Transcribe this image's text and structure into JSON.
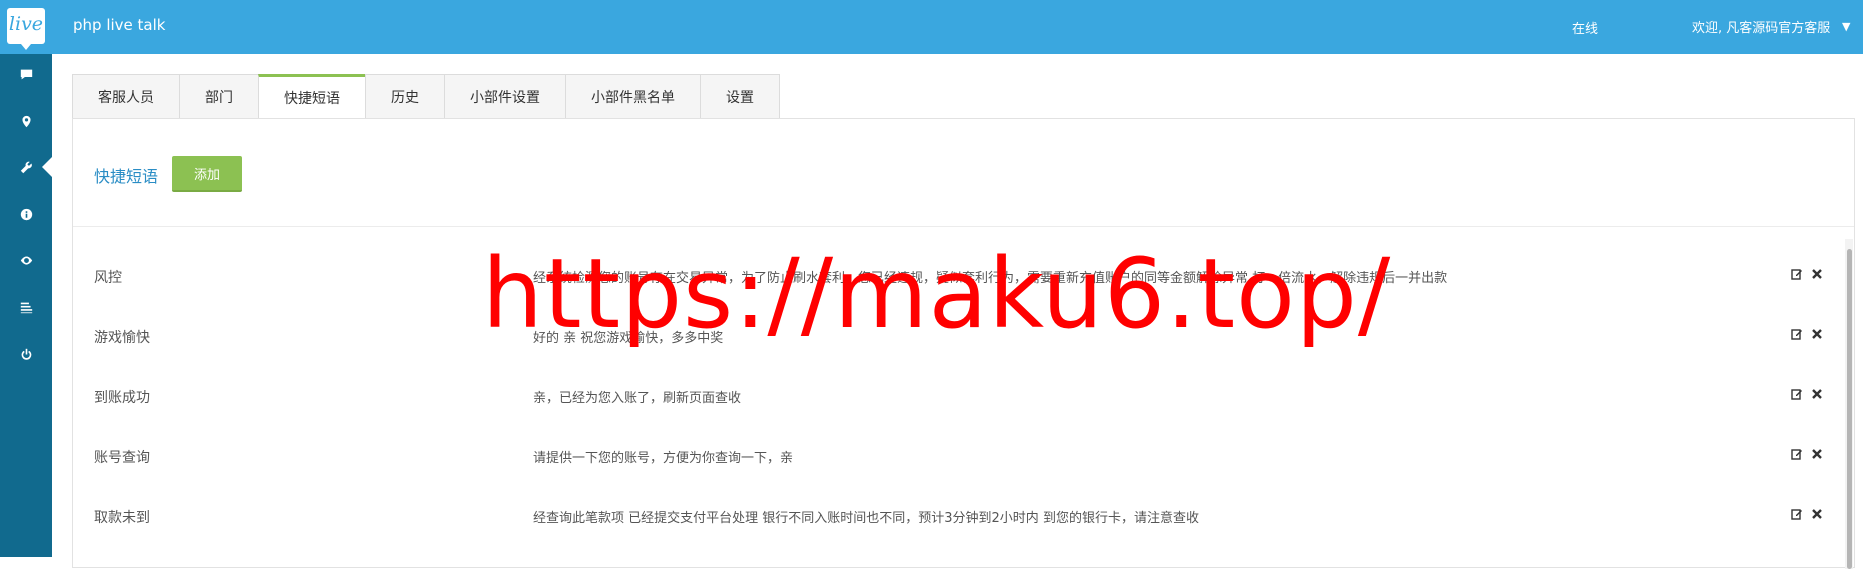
{
  "header": {
    "logo_text": "live",
    "app_title": "php live talk",
    "status": "在线",
    "welcome": "欢迎, 凡客源码官方客服",
    "caret_icon": "chevron-down-icon"
  },
  "sidebar": {
    "items": [
      {
        "name": "chat",
        "icon": "chat-icon"
      },
      {
        "name": "location",
        "icon": "map-pin-icon"
      },
      {
        "name": "tools",
        "icon": "wrench-icon",
        "active": true
      },
      {
        "name": "info",
        "icon": "info-icon"
      },
      {
        "name": "monitor",
        "icon": "eye-icon"
      },
      {
        "name": "list",
        "icon": "list-icon"
      },
      {
        "name": "logout",
        "icon": "power-icon"
      }
    ]
  },
  "tabs": [
    {
      "label": "客服人员"
    },
    {
      "label": "部门"
    },
    {
      "label": "快捷短语",
      "active": true
    },
    {
      "label": "历史"
    },
    {
      "label": "小部件设置"
    },
    {
      "label": "小部件黑名单"
    },
    {
      "label": "设置"
    }
  ],
  "panel": {
    "title": "快捷短语",
    "add_label": "添加"
  },
  "phrases": [
    {
      "name": "风控",
      "text": "经系统检测您的账号存在交易异常，为了防止刷水套利，您已经违规，疑似套利行为，需要重新充值账户的同等金额解除异常 打一倍流水，解除违规后一并出款"
    },
    {
      "name": "游戏愉快",
      "text": "好的 亲 祝您游戏愉快，多多中奖"
    },
    {
      "name": "到账成功",
      "text": "亲，已经为您入账了，刷新页面查收"
    },
    {
      "name": "账号查询",
      "text": "请提供一下您的账号，方便为你查询一下，亲"
    },
    {
      "name": "取款未到",
      "text": "经查询此笔款项 已经提交支付平台处理 银行不同入账时间也不同，预计3分钟到2小时内 到您的银行卡，请注意查收"
    }
  ],
  "watermark": "https://maku6.top/",
  "colors": {
    "header_bg": "#3aa7df",
    "sidebar_bg": "#116a8e",
    "add_button": "#8cc152",
    "title_link": "#2a8dc5",
    "watermark": "#ff0000"
  }
}
